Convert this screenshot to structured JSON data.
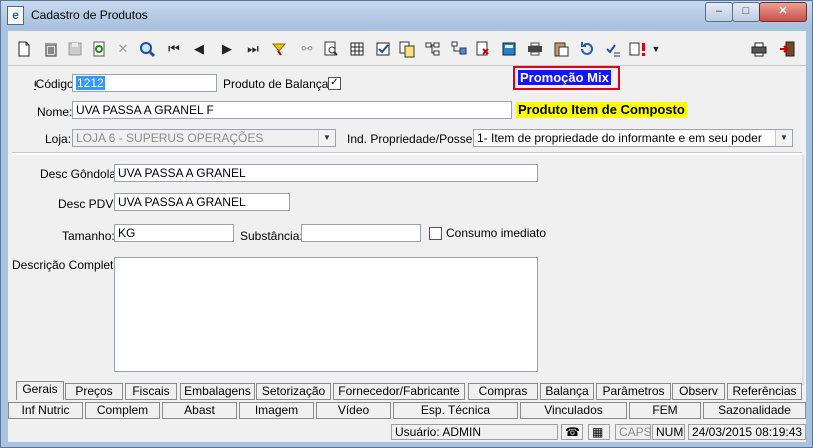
{
  "window": {
    "title": "Cadastro de Produtos",
    "minimize_label": "–",
    "maximize_label": "□",
    "close_label": "✕"
  },
  "form": {
    "codigo_label": "Código:",
    "codigo_value": "1212",
    "balanca_label": "Produto de Balança",
    "balanca_checked": "✓",
    "promo_mix": "Promoção Mix",
    "nome_label": "Nome:",
    "nome_value": "UVA PASSA A GRANEL F",
    "item_composto": "Produto Item de Composto",
    "loja_label": "Loja:",
    "loja_value": "LOJA 6 - SUPERUS OPERAÇÕES",
    "ind_label": "Ind. Propriedade/Posse:",
    "ind_value": "1- Item de propriedade do informante e em seu poder",
    "desc_gondola_label": "Desc Gôndola:",
    "desc_gondola_value": "UVA PASSA A GRANEL",
    "desc_pdv_label": "Desc PDV:",
    "desc_pdv_value": "UVA PASSA A GRANEL",
    "tamanho_label": "Tamanho:",
    "tamanho_value": "KG",
    "substancia_label": "Substância:",
    "substancia_value": "",
    "consumo_label": "Consumo imediato",
    "descricao_label": "Descrição Completa:",
    "descricao_value": ""
  },
  "toolbar_icons": [
    "new-icon",
    "delete-icon",
    "save-icon",
    "refresh-icon",
    "cancel-icon",
    "search-icon",
    "first-icon",
    "prev-icon",
    "next-icon",
    "last-icon",
    "filter-icon",
    "binoculars-icon",
    "find-doc-icon",
    "grid-icon",
    "check-doc-icon",
    "copy-doc-icon",
    "tree-icon",
    "tree2-icon",
    "doc-x-icon",
    "calculator-icon",
    "printer-small-icon",
    "clipboard-icon",
    "rotate-icon",
    "checklist-icon",
    "alert-icon",
    "dropdown-icon",
    "print-icon",
    "exit-icon"
  ],
  "tabs_row1": [
    {
      "label": "Gerais",
      "active": true
    },
    {
      "label": "Preços"
    },
    {
      "label": "Fiscais"
    },
    {
      "label": "Embalagens"
    },
    {
      "label": "Setorização"
    },
    {
      "label": "Fornecedor/Fabricante"
    },
    {
      "label": "Compras"
    },
    {
      "label": "Balança"
    },
    {
      "label": "Parâmetros"
    },
    {
      "label": "Observ"
    },
    {
      "label": "Referências"
    }
  ],
  "tabs_row2": [
    {
      "label": "Inf Nutric"
    },
    {
      "label": "Complem"
    },
    {
      "label": "Abast"
    },
    {
      "label": "Imagem"
    },
    {
      "label": "Vídeo"
    },
    {
      "label": "Esp. Técnica"
    },
    {
      "label": "Vinculados"
    },
    {
      "label": "FEM"
    },
    {
      "label": "Sazonalidade"
    }
  ],
  "status": {
    "usuario": "Usuário: ADMIN",
    "caps": "CAPS",
    "num": "NUM",
    "datetime": "24/03/2015 08:19:43"
  }
}
